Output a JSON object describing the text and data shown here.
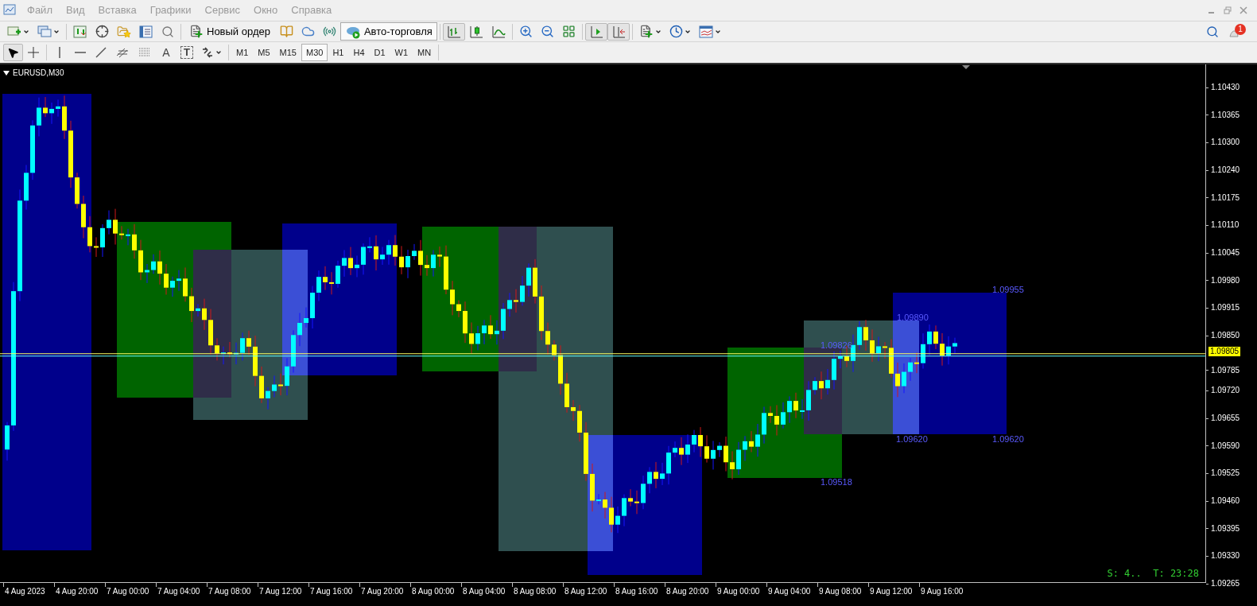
{
  "menu": [
    "Файл",
    "Вид",
    "Вставка",
    "Графики",
    "Сервис",
    "Окно",
    "Справка"
  ],
  "toolbar": {
    "new_order": "Новый ордер",
    "auto_trading": {
      "label": "Авто-торговля",
      "on": true
    },
    "chart_modes": [
      {
        "selected": true
      },
      {
        "selected": false
      },
      {
        "selected": false
      }
    ],
    "autoscroll_on": true,
    "chart_shift_on": true,
    "notifications": "1"
  },
  "drawing_tools": {
    "cursor_tools": [
      {
        "selected": true
      },
      {
        "selected": false
      }
    ],
    "text_tool_glyph": "A",
    "label_tool_glyph": "T"
  },
  "timeframes": [
    {
      "label": "M1",
      "selected": false
    },
    {
      "label": "M5",
      "selected": false
    },
    {
      "label": "M15",
      "selected": false
    },
    {
      "label": "M30",
      "selected": true
    },
    {
      "label": "H1",
      "selected": false
    },
    {
      "label": "H4",
      "selected": false
    },
    {
      "label": "D1",
      "selected": false
    },
    {
      "label": "W1",
      "selected": false
    },
    {
      "label": "MN",
      "selected": false
    }
  ],
  "chart": {
    "title": "EURUSD,M30",
    "price_axis": [
      "1.10430",
      "1.10365",
      "1.10300",
      "1.10240",
      "1.10175",
      "1.10110",
      "1.10045",
      "1.09980",
      "1.09915",
      "1.09850",
      "1.09785",
      "1.09720",
      "1.09655",
      "1.09590",
      "1.09525",
      "1.09460",
      "1.09395",
      "1.09330",
      "1.09265"
    ],
    "current_price": "1.09805",
    "time_axis": [
      "4 Aug 2023",
      "4 Aug 20:00",
      "7 Aug 00:00",
      "7 Aug 04:00",
      "7 Aug 08:00",
      "7 Aug 12:00",
      "7 Aug 16:00",
      "7 Aug 20:00",
      "8 Aug 00:00",
      "8 Aug 04:00",
      "8 Aug 08:00",
      "8 Aug 12:00",
      "8 Aug 16:00",
      "8 Aug 20:00",
      "9 Aug 00:00",
      "9 Aug 04:00",
      "9 Aug 08:00",
      "9 Aug 12:00",
      "9 Aug 16:00"
    ],
    "box_labels": [
      "1.09955",
      "1.09890",
      "1.09826",
      "1.09620",
      "1.09620",
      "1.09518"
    ],
    "status": "S: 4..  T: 23:28"
  }
}
